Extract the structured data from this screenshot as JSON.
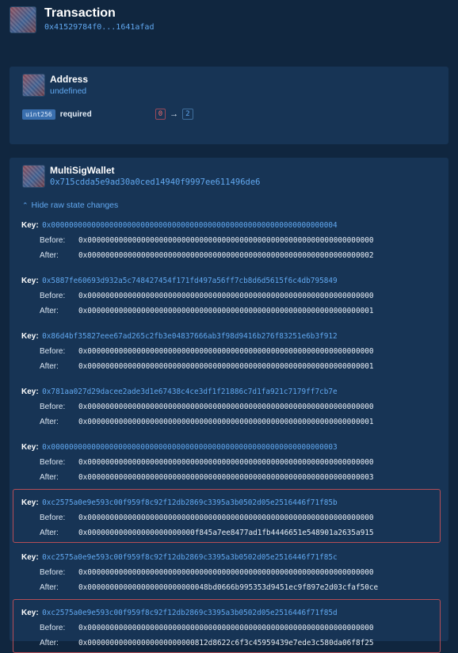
{
  "header": {
    "title": "Transaction",
    "hash": "0x41529784f0...1641afad"
  },
  "address_card": {
    "title": "Address",
    "subtitle": "undefined",
    "param": {
      "type": "uint256",
      "name": "required",
      "old_value": "0",
      "arrow": "→",
      "new_value": "2"
    }
  },
  "wallet_card": {
    "title": "MultiSigWallet",
    "address": "0x715cdda5e9ad30a0ced14940f9997ee611496de6",
    "toggle_label": "Hide raw state changes",
    "key_label": "Key:",
    "before_label": "Before:",
    "after_label": "After:",
    "changes": [
      {
        "key": "0x0000000000000000000000000000000000000000000000000000000000000004",
        "before": "0x0000000000000000000000000000000000000000000000000000000000000000",
        "after": "0x0000000000000000000000000000000000000000000000000000000000000002",
        "highlighted": false
      },
      {
        "key": "0x5887fe60693d932a5c748427454f171fd497a56ff7cb8d6d5615f6c4db795849",
        "before": "0x0000000000000000000000000000000000000000000000000000000000000000",
        "after": "0x0000000000000000000000000000000000000000000000000000000000000001",
        "highlighted": false
      },
      {
        "key": "0x86d4bf35827eee67ad265c2fb3e04837666ab3f98d9416b276f83251e6b3f912",
        "before": "0x0000000000000000000000000000000000000000000000000000000000000000",
        "after": "0x0000000000000000000000000000000000000000000000000000000000000001",
        "highlighted": false
      },
      {
        "key": "0x781aa027d29dacee2ade3d1e67438c4ce3df1f21886c7d1fa921c7179ff7cb7e",
        "before": "0x0000000000000000000000000000000000000000000000000000000000000000",
        "after": "0x0000000000000000000000000000000000000000000000000000000000000001",
        "highlighted": false
      },
      {
        "key": "0x0000000000000000000000000000000000000000000000000000000000000003",
        "before": "0x0000000000000000000000000000000000000000000000000000000000000000",
        "after": "0x0000000000000000000000000000000000000000000000000000000000000003",
        "highlighted": false
      },
      {
        "key": "0xc2575a0e9e593c00f959f8c92f12db2869c3395a3b0502d05e2516446f71f85b",
        "before": "0x0000000000000000000000000000000000000000000000000000000000000000",
        "after": "0x000000000000000000000000f845a7ee8477ad1fb4446651e548901a2635a915",
        "highlighted": true
      },
      {
        "key": "0xc2575a0e9e593c00f959f8c92f12db2869c3395a3b0502d05e2516446f71f85c",
        "before": "0x0000000000000000000000000000000000000000000000000000000000000000",
        "after": "0x000000000000000000000000048bd0666b995353d9451ec9f897e2d03cfaf50ce",
        "highlighted": false
      },
      {
        "key": "0xc2575a0e9e593c00f959f8c92f12db2869c3395a3b0502d05e2516446f71f85d",
        "before": "0x0000000000000000000000000000000000000000000000000000000000000000",
        "after": "0x000000000000000000000000812d8622c6f3c45959439e7ede3c580da06f8f25",
        "highlighted": true
      }
    ]
  }
}
